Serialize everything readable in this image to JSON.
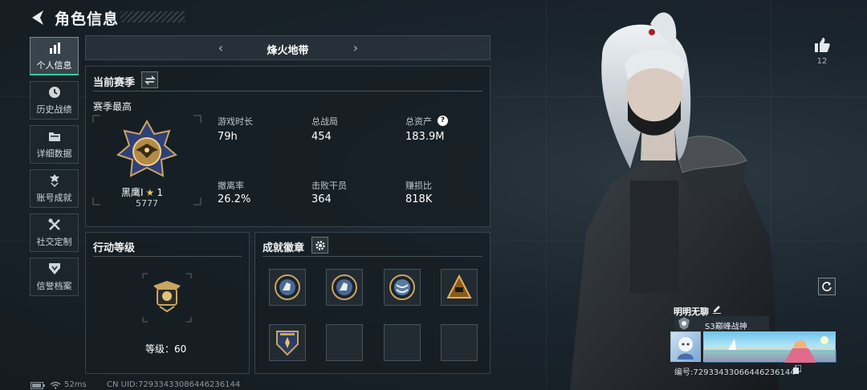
{
  "header": {
    "title": "角色信息"
  },
  "sidebar": {
    "items": [
      {
        "label": "个人信息",
        "icon": "bar-chart-icon",
        "active": true
      },
      {
        "label": "历史战绩",
        "icon": "clock-icon"
      },
      {
        "label": "详细数据",
        "icon": "folder-icon"
      },
      {
        "label": "账号成就",
        "icon": "trophy-icon"
      },
      {
        "label": "社交定制",
        "icon": "tools-icon"
      },
      {
        "label": "信誉档案",
        "icon": "shield-icon"
      }
    ]
  },
  "mode_selector": {
    "name": "烽火地带",
    "prev": "‹",
    "next": "›"
  },
  "season": {
    "title": "当前赛季",
    "subtitle": "赛季最高",
    "rank_name": "黑鹰I",
    "rank_stars": "1",
    "rank_points": "5777",
    "stats": [
      {
        "label": "游戏时长",
        "value": "79h"
      },
      {
        "label": "总战局",
        "value": "454"
      },
      {
        "label": "总资产",
        "value": "183.9M",
        "help": "?"
      },
      {
        "label": "撤离率",
        "value": "26.2%"
      },
      {
        "label": "击败干员",
        "value": "364"
      },
      {
        "label": "赚损比",
        "value": "818K"
      }
    ]
  },
  "action_level": {
    "title": "行动等级",
    "level_text": "等级：60"
  },
  "achievements": {
    "title": "成就徽章"
  },
  "profile": {
    "likes": "12",
    "player_name": "明明无聊",
    "player_title": "S3巅峰战神",
    "id_text": "编号:7293343306644623614​4"
  },
  "status_bar": {
    "ping": "52ms",
    "uid": "CN UID:72933433086446236144"
  },
  "colors": {
    "accent": "#2bd1a2",
    "gold": "#c9a560",
    "panel_bg": "#161e24"
  }
}
